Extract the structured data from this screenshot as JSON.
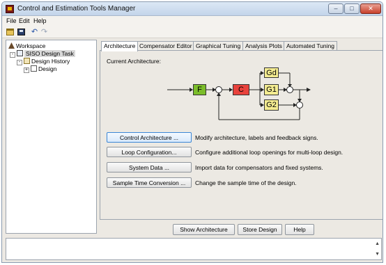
{
  "window": {
    "title": "Control and Estimation Tools Manager"
  },
  "menu": [
    "File",
    "Edit",
    "Help"
  ],
  "toolbar": {
    "icons": [
      "open-icon",
      "save-icon",
      "undo-icon",
      "redo-icon"
    ]
  },
  "tree": {
    "workspace": "Workspace",
    "task": "SISO Design Task",
    "history": "Design History",
    "design": "Design"
  },
  "tabs": [
    "Architecture",
    "Compensator Editor",
    "Graphical Tuning",
    "Analysis Plots",
    "Automated Tuning"
  ],
  "architecture": {
    "current_label": "Current Architecture:",
    "blocks": {
      "f": "F",
      "c": "C",
      "gd": "Gd",
      "g1": "G1",
      "g2": "G2"
    },
    "actions": [
      {
        "label": "Control Architecture ...",
        "desc": "Modify architecture, labels and feedback signs."
      },
      {
        "label": "Loop Configuration...",
        "desc": "Configure additional loop openings for multi-loop design."
      },
      {
        "label": "System Data ...",
        "desc": "Import data for compensators and fixed systems."
      },
      {
        "label": "Sample Time Conversion ...",
        "desc": "Change the sample time of the design."
      }
    ]
  },
  "bottom_buttons": {
    "show": "Show Architecture",
    "store": "Store Design",
    "help": "Help"
  },
  "colors": {
    "f_block": "#7bbd2a",
    "c_block": "#e8423c",
    "g_block": "#f4ec91"
  }
}
